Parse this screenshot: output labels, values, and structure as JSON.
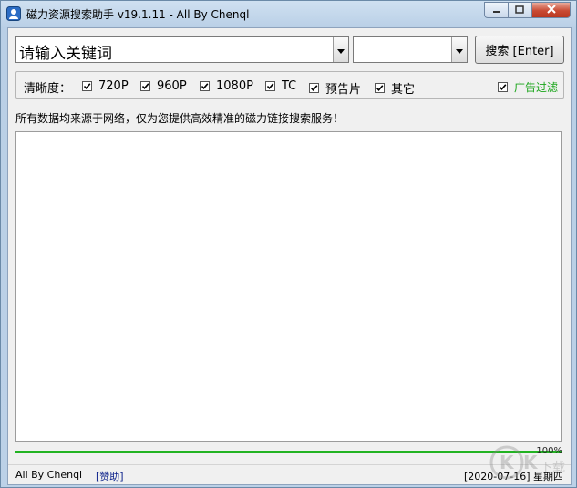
{
  "window": {
    "title": "磁力资源搜索助手 v19.1.11 - All By Chenql"
  },
  "search": {
    "keyword_placeholder": "请输入关键词",
    "category_value": "",
    "search_button": "搜索 [Enter]"
  },
  "quality": {
    "label": "清晰度：",
    "options": [
      {
        "label": "720P",
        "checked": true
      },
      {
        "label": "960P",
        "checked": true
      },
      {
        "label": "1080P",
        "checked": true
      },
      {
        "label": "TC",
        "checked": true
      },
      {
        "label": "预告片",
        "checked": true
      },
      {
        "label": "其它",
        "checked": true
      }
    ],
    "ad_filter": {
      "label": "广告过滤",
      "checked": true
    }
  },
  "notice": "所有数据均来源于网络，仅为您提供高效精准的磁力链接搜索服务！",
  "progress": {
    "value": 100,
    "text": "100%"
  },
  "statusbar": {
    "author": "All By Chenql",
    "donate": "[赞助]",
    "date": "[2020-07-16] 星期四"
  },
  "colors": {
    "progress_fill": "#22b322",
    "ad_filter_text": "#1aa51a",
    "donate_link": "#0a1f8a",
    "close_button": "#c94a33"
  },
  "watermark": {
    "text": "KK下载"
  }
}
